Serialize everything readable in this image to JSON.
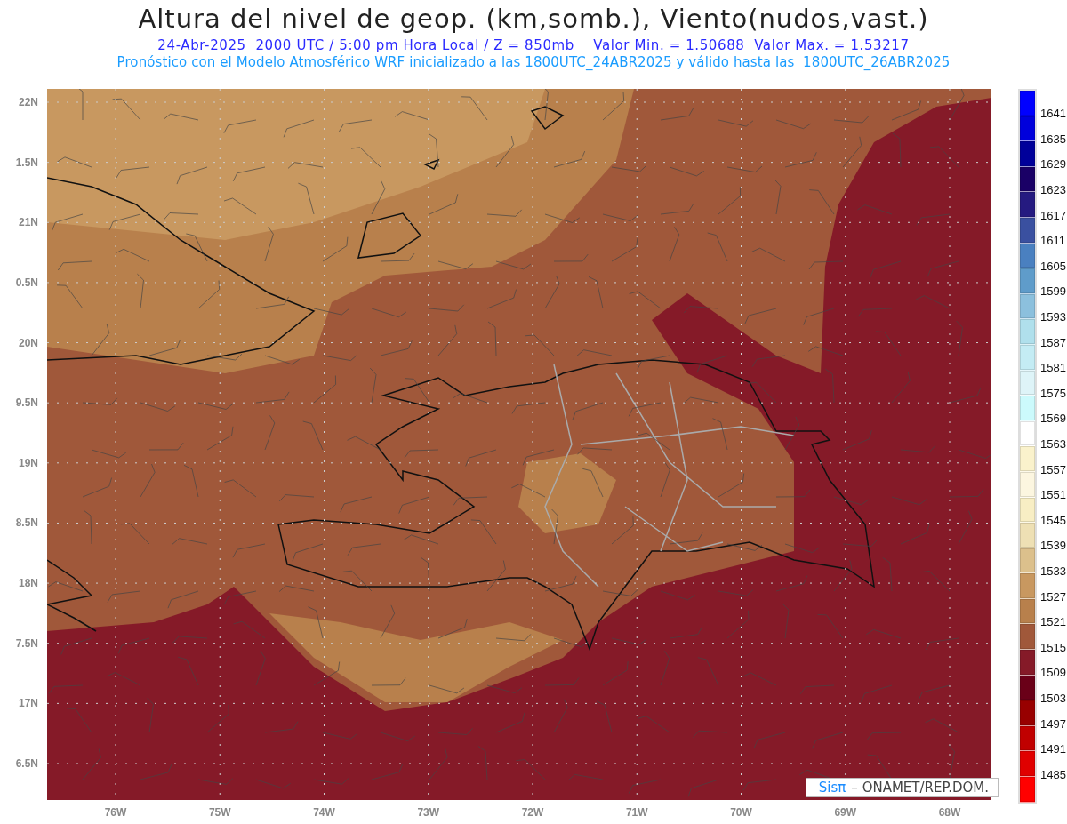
{
  "title": "Altura del nivel de geop. (km,somb.), Viento(nudos,vast.)",
  "subtitle": "24-Abr-2025  2000 UTC / 5:00 pm Hora Local / Z = 850mb    Valor Min. = 1.50688  Valor Max. = 1.53217",
  "forecast_note": "Pronóstico con el Modelo Atmosférico WRF inicializado a las 1800UTC_24ABR2025 y válido hasta las  1800UTC_26ABR2025",
  "y_axis": [
    "22N",
    "1.5N",
    "21N",
    "0.5N",
    "20N",
    "9.5N",
    "19N",
    "8.5N",
    "18N",
    "7.5N",
    "17N",
    "6.5N"
  ],
  "x_axis": [
    "76W",
    "75W",
    "74W",
    "73W",
    "72W",
    "71W",
    "70W",
    "69W",
    "68W"
  ],
  "colorbar": {
    "cells": [
      {
        "color": "#0000ff"
      },
      {
        "color": "#0000dc"
      },
      {
        "color": "#00009a"
      },
      {
        "color": "#1a0066"
      },
      {
        "color": "#251a80"
      },
      {
        "color": "#3a50a0"
      },
      {
        "color": "#4a80c0"
      },
      {
        "color": "#5f9cca"
      },
      {
        "color": "#8cc0dd"
      },
      {
        "color": "#b0e0ec"
      },
      {
        "color": "#c4ecf4"
      },
      {
        "color": "#def4f8"
      },
      {
        "color": "#ccfafc"
      },
      {
        "color": "#ffffff"
      },
      {
        "color": "#faf2cc"
      },
      {
        "color": "#fcf6e0"
      },
      {
        "color": "#f8eec4"
      },
      {
        "color": "#eee0b4"
      },
      {
        "color": "#dcc08c"
      },
      {
        "color": "#c89860"
      },
      {
        "color": "#b8804c"
      },
      {
        "color": "#a0583a"
      },
      {
        "color": "#851a28"
      },
      {
        "color": "#6a0018"
      },
      {
        "color": "#980000"
      },
      {
        "color": "#c00000"
      },
      {
        "color": "#e00000"
      },
      {
        "color": "#ff0000"
      }
    ],
    "labels": [
      "1641",
      "1635",
      "1629",
      "1623",
      "1617",
      "1611",
      "1605",
      "1599",
      "1593",
      "1587",
      "1581",
      "1575",
      "1569",
      "1563",
      "1557",
      "1551",
      "1545",
      "1539",
      "1533",
      "1527",
      "1521",
      "1515",
      "1509",
      "1503",
      "1497",
      "1491",
      "1485"
    ]
  },
  "credit": {
    "logo": "Sisπ",
    "text": "– ONAMET/REP.DOM."
  }
}
